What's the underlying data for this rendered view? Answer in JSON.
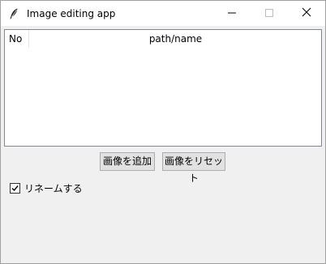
{
  "window": {
    "title": "Image editing app",
    "controls": {
      "minimize": "minimize-icon",
      "maximize": "maximize-icon",
      "close": "close-icon"
    }
  },
  "table": {
    "columns": [
      "No",
      "path/name"
    ],
    "rows": []
  },
  "buttons": {
    "add_images": "画像を追加",
    "reset_images": "画像をリセット"
  },
  "options": {
    "rename_label": "リネームする",
    "rename_checked": true
  },
  "colors": {
    "titlebar_bg": "#ffffff",
    "client_bg": "#f0f0f0",
    "button_bg": "#e1e1e1",
    "button_border": "#adadad"
  }
}
